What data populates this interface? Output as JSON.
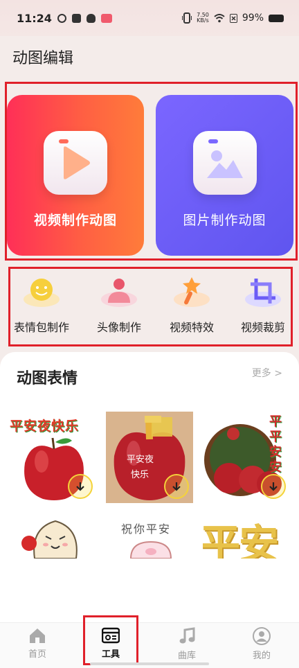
{
  "status": {
    "time": "11:24",
    "net_speed_value": "7.50",
    "net_speed_unit": "KB/s",
    "battery": "99%"
  },
  "page": {
    "title": "动图编辑"
  },
  "hero": {
    "video_label": "视频制作动图",
    "image_label": "图片制作动图"
  },
  "tools": [
    {
      "label": "表情包制作",
      "icon": "smiley-icon"
    },
    {
      "label": "头像制作",
      "icon": "avatar-person-icon"
    },
    {
      "label": "视频特效",
      "icon": "magic-wand-icon"
    },
    {
      "label": "视频裁剪",
      "icon": "crop-icon"
    }
  ],
  "section": {
    "title": "动图表情",
    "more": "更多 >"
  },
  "gifs": [
    {
      "caption_top": "平安夜快乐"
    },
    {
      "caption_1": "平安夜",
      "caption_2": "快乐"
    },
    {
      "caption": "平平安安"
    },
    {
      "caption": ""
    },
    {
      "caption": "祝你平安"
    },
    {
      "caption": "平安"
    }
  ],
  "tabbar": {
    "items": [
      {
        "label": "首页"
      },
      {
        "label": "工具"
      },
      {
        "label": "曲库"
      },
      {
        "label": "我的"
      }
    ],
    "active_index": 1
  },
  "colors": {
    "accent_red": "#e0202a",
    "video_card": "#ff4a4a",
    "image_card": "#6b5cf6",
    "download_ring": "#f4d33a"
  }
}
